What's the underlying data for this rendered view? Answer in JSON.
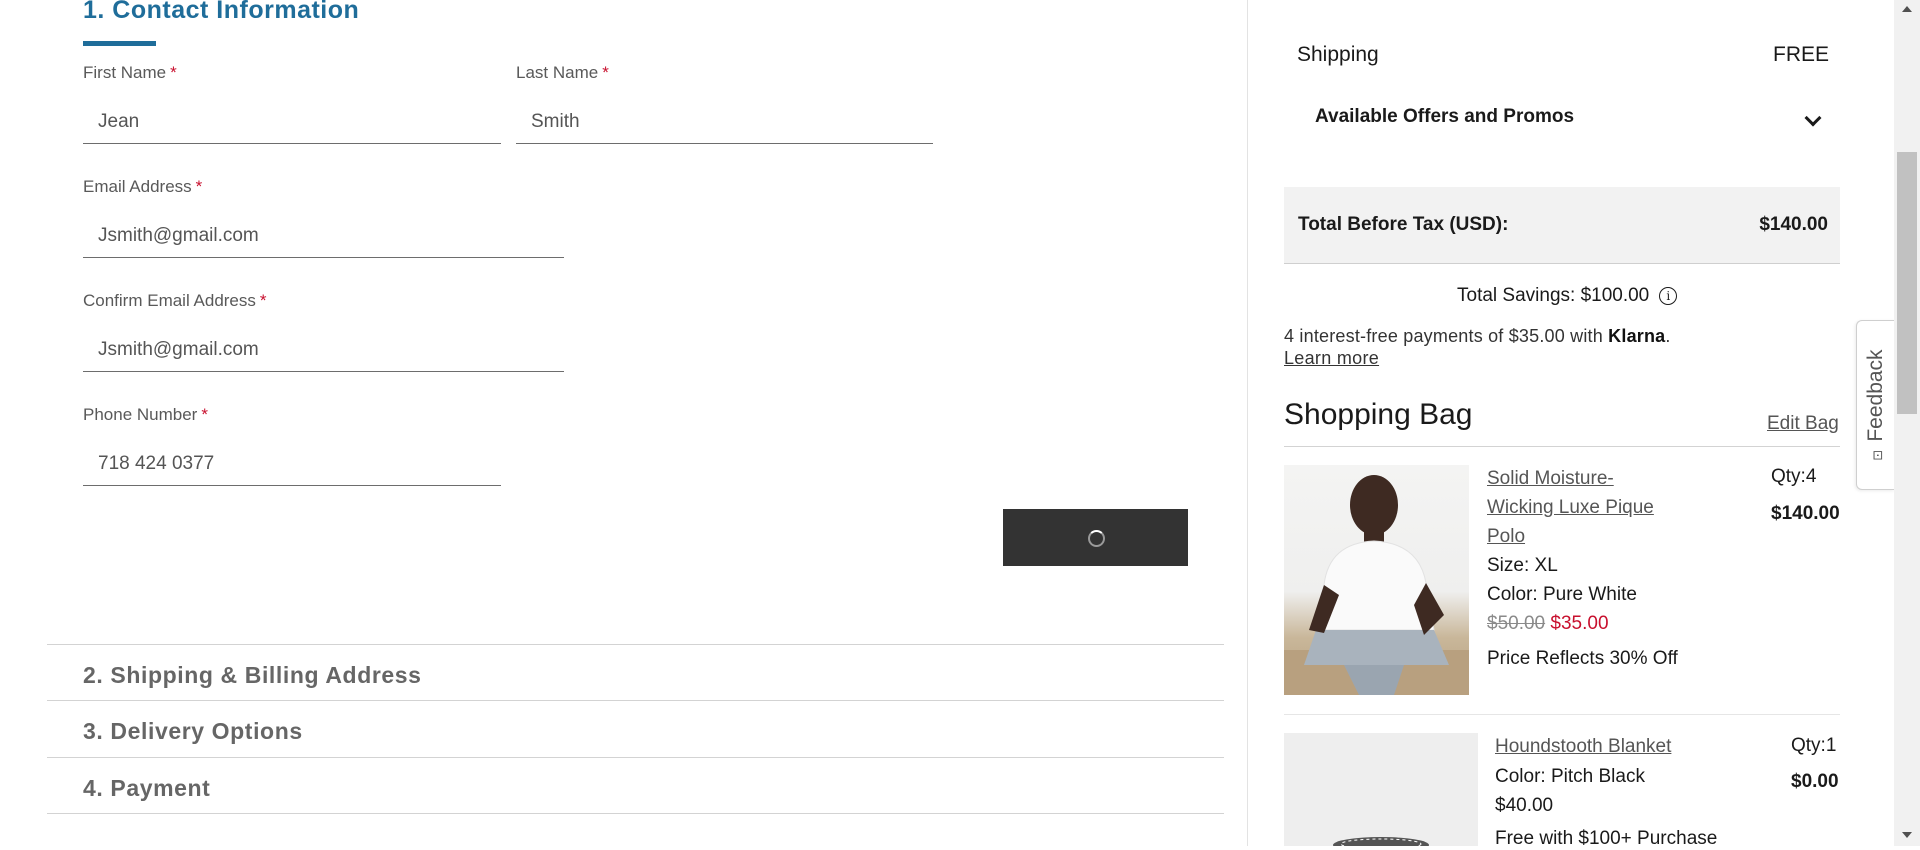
{
  "contact": {
    "heading": "1. Contact Information",
    "first_name": {
      "label": "First Name",
      "required_mark": "*",
      "value": "Jean"
    },
    "last_name": {
      "label": "Last Name",
      "required_mark": "*",
      "value": "Smith"
    },
    "email": {
      "label": "Email Address",
      "required_mark": "*",
      "value": "Jsmith@gmail.com"
    },
    "confirm_email": {
      "label": "Confirm Email Address",
      "required_mark": "*",
      "value": "Jsmith@gmail.com"
    },
    "phone": {
      "label": "Phone Number",
      "required_mark": "*",
      "value": "718 424 0377"
    },
    "continue_button": {
      "state": "loading",
      "icon": "spinner-icon"
    }
  },
  "steps": [
    {
      "label": "2. Shipping & Billing Address"
    },
    {
      "label": "3. Delivery Options"
    },
    {
      "label": "4. Payment"
    }
  ],
  "summary": {
    "shipping_label": "Shipping",
    "shipping_value": "FREE",
    "offers_label": "Available Offers and Promos",
    "total_label": "Total Before Tax (USD):",
    "total_value": "$140.00",
    "savings_text": "Total Savings: $100.00",
    "info_icon_glyph": "i",
    "klarna_text": "4 interest-free payments of $35.00 with ",
    "klarna_brand": "Klarna",
    "klarna_period": ".",
    "learn_more": "Learn more"
  },
  "bag": {
    "title": "Shopping Bag",
    "edit_label": "Edit Bag",
    "items": [
      {
        "name": "Solid Moisture-Wicking Luxe Pique Polo",
        "size": "Size: XL",
        "color": "Color: Pure White",
        "original_price": "$50.00",
        "sale_price": "$35.00",
        "note": "Price Reflects 30% Off",
        "qty": "Qty:4",
        "line_total": "$140.00"
      },
      {
        "name": "Houndstooth Blanket",
        "color": "Color: Pitch Black",
        "price": "$40.00",
        "note": "Free with $100+ Purchase",
        "qty": "Qty:1",
        "line_total": "$0.00"
      }
    ]
  },
  "feedback": {
    "label": "Feedback",
    "icon": "feedback-icon"
  },
  "colors": {
    "accent": "#1f6d9a",
    "required": "#c8102e",
    "sale": "#c8102e",
    "button": "#333333"
  }
}
